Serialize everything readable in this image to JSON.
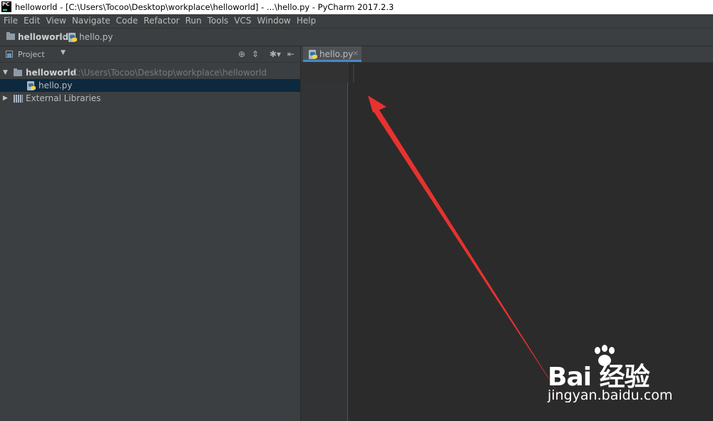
{
  "window": {
    "title": "helloworld - [C:\\Users\\Tocoo\\Desktop\\workplace\\helloworld] - ...\\hello.py - PyCharm 2017.2.3",
    "logo_text": "PC"
  },
  "menu": [
    "File",
    "Edit",
    "View",
    "Navigate",
    "Code",
    "Refactor",
    "Run",
    "Tools",
    "VCS",
    "Window",
    "Help"
  ],
  "breadcrumb": {
    "project": "helloworld",
    "file": "hello.py"
  },
  "project_panel": {
    "label": "Project",
    "tools": [
      "target-icon",
      "collapse-icon",
      "gear-icon",
      "hide-icon"
    ],
    "tree": {
      "project_name": "helloworld",
      "project_path": "C:\\Users\\Tocoo\\Desktop\\workplace\\helloworld",
      "file": "hello.py",
      "external": "External Libraries"
    }
  },
  "editor": {
    "tab": "hello.py",
    "tab_close": "×"
  },
  "watermark": {
    "brand": "Bai  经验",
    "url": "jingyan.baidu.com"
  },
  "colors": {
    "annotation_arrow": "#e8322f",
    "selection": "#0d293e",
    "tab_underline": "#4a88c7"
  }
}
